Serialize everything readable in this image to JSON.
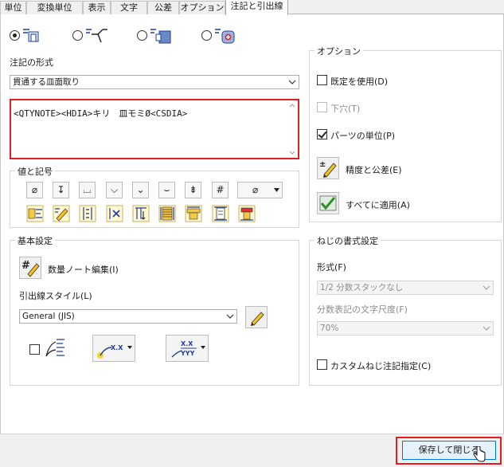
{
  "tabs": [
    {
      "label": "単位"
    },
    {
      "label": "変換単位"
    },
    {
      "label": "表示"
    },
    {
      "label": "文字"
    },
    {
      "label": "公差"
    },
    {
      "label": "オプション"
    },
    {
      "label": "注記と引出線",
      "active": true
    }
  ],
  "note_types": {
    "items": [
      {
        "icon": "hole-note-icon",
        "selected": true
      },
      {
        "icon": "thread-note-icon",
        "selected": false
      },
      {
        "icon": "chamfer-note-icon",
        "selected": false
      },
      {
        "icon": "punch-note-icon",
        "selected": false
      }
    ]
  },
  "note_format": {
    "label": "注記の形式",
    "dropdown_value": "貫通する皿面取り",
    "text": "<QTYNOTE><HDIA>キリ　皿モミØ<CSDIA>"
  },
  "options": {
    "title": "オプション",
    "use_default": {
      "label": "既定を使用(D)",
      "checked": false
    },
    "prepared_hole": {
      "label": "下穴(T)",
      "checked": false,
      "disabled": true
    },
    "part_units": {
      "label": "パーツの単位(P)",
      "checked": true
    },
    "precision_button": {
      "label": "精度と公差(E)",
      "icon": "precision-pencil-icon"
    },
    "apply_all_button": {
      "label": "すべてに適用(A)",
      "icon": "apply-all-icon"
    }
  },
  "values_symbols": {
    "title": "値と記号",
    "row1": [
      "⌀",
      "↧",
      "⌴",
      "⌵",
      "⌄",
      "⌣",
      "⇟",
      "#"
    ],
    "diameter_dropdown": "⌀",
    "row2_icons": [
      "hole-diameter-icon",
      "thread-edit-icon",
      "hole-depth-icon",
      "thread-depth-icon",
      "counterbore-depth-icon",
      "thread-designation-icon",
      "cbore-diameter-icon",
      "spotface-icon",
      "countersink-diameter-icon"
    ]
  },
  "basic_settings": {
    "title": "基本設定",
    "qty_note_button": "数量ノート編集(I)",
    "leader_style_label": "引出線スタイル(L)",
    "leader_style_value": "General (JIS)",
    "xx_label": "X.X",
    "xx_yyy_label1": "X.X",
    "xx_yyy_label2": "YYY"
  },
  "thread_format": {
    "title": "ねじの書式設定",
    "format_label": "形式(F)",
    "format_value": "1/2 分数スタックなし",
    "fraction_scale_label": "分数表記の文字尺度(F)",
    "fraction_scale_value": "70%",
    "custom_note": {
      "label": "カスタムねじ注記指定(C)",
      "checked": false
    }
  },
  "footer": {
    "save_close": "保存して閉じる"
  },
  "colors": {
    "highlight_red": "#e02020",
    "button_blue": "#0078d7"
  }
}
